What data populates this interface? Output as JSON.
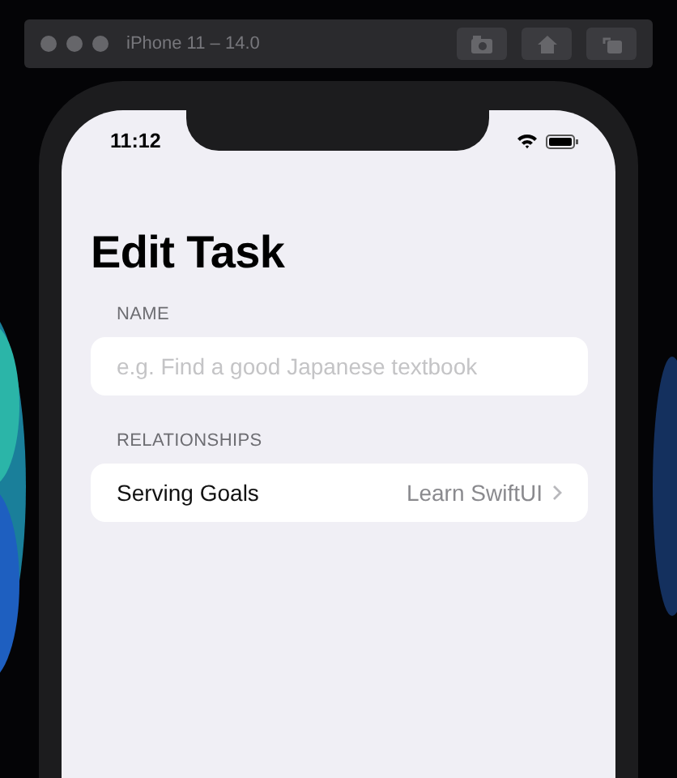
{
  "simulator": {
    "title": "iPhone 11 – 14.0"
  },
  "status_bar": {
    "time": "11:12"
  },
  "navigation": {
    "title": "Edit Task"
  },
  "sections": [
    {
      "header": "NAME",
      "rows": [
        {
          "kind": "text_field",
          "placeholder": "e.g. Find a good Japanese textbook"
        }
      ]
    },
    {
      "header": "RELATIONSHIPS",
      "rows": [
        {
          "kind": "link",
          "label": "Serving Goals",
          "value": "Learn SwiftUI"
        }
      ]
    }
  ]
}
